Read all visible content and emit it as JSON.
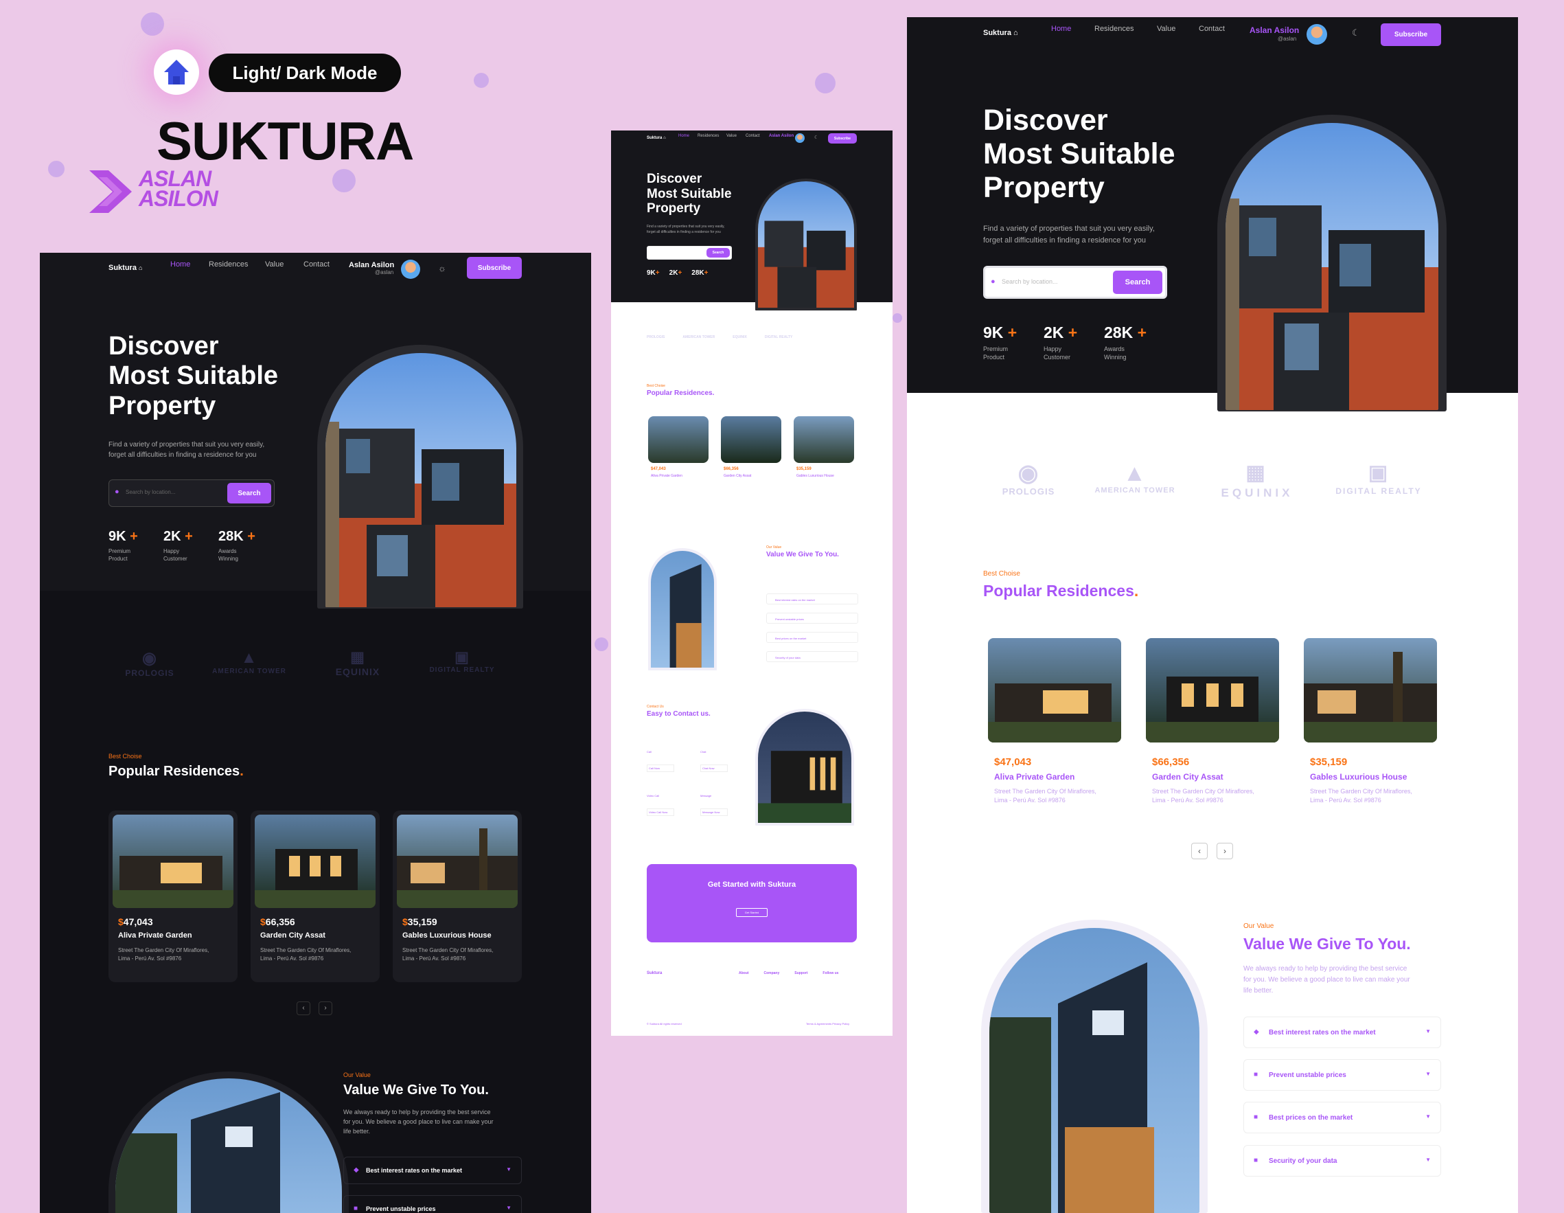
{
  "brand": {
    "mode_pill": "Light/ Dark Mode",
    "title": "SUKTURA",
    "author_line1": "ASLAN",
    "author_line2": "ASILON"
  },
  "nav": {
    "logo": "Suktura",
    "links": [
      "Home",
      "Residences",
      "Value",
      "Contact"
    ],
    "user_name": "Aslan Asilon",
    "user_handle": "@aslan",
    "subscribe": "Subscribe"
  },
  "hero": {
    "title_lines": [
      "Discover",
      "Most Suitable",
      "Property"
    ],
    "subtitle_1": "Find a variety of properties that suit you very easily,",
    "subtitle_2": "forget all difficulties in finding a residence for you",
    "search_placeholder": "Search by location...",
    "search_button": "Search",
    "stats": [
      {
        "num": "9K",
        "plus": "+",
        "label1": "Premium",
        "label2": "Product"
      },
      {
        "num": "2K",
        "plus": "+",
        "label1": "Happy",
        "label2": "Customer"
      },
      {
        "num": "28K",
        "plus": "+",
        "label1": "Awards",
        "label2": "Winning"
      }
    ]
  },
  "partners": [
    "PROLOGIS",
    "AMERICAN TOWER",
    "EQUINIX",
    "DIGITAL REALTY"
  ],
  "residences": {
    "eyebrow": "Best Choise",
    "title": "Popular Residences",
    "dot": ".",
    "cards": [
      {
        "price_sign": "$",
        "price": "47,043",
        "name": "Aliva Private Garden",
        "addr1": "Street The Garden City Of Miraflores,",
        "addr2": "Lima - Perú Av. Sol #9876"
      },
      {
        "price_sign": "$",
        "price": "66,356",
        "name": "Garden City Assat",
        "addr1": "Street The Garden City Of Miraflores,",
        "addr2": "Lima - Perú Av. Sol #9876"
      },
      {
        "price_sign": "$",
        "price": "35,159",
        "name": "Gables Luxurious House",
        "addr1": "Street The Garden City Of Miraflores,",
        "addr2": "Lima - Perú Av. Sol #9876"
      }
    ]
  },
  "value": {
    "eyebrow": "Our Value",
    "title": "Value We Give To You.",
    "desc_1": "We always ready to help by providing the best service",
    "desc_2": "for you. We believe a good place to live can make your",
    "desc_3": "life better.",
    "items": [
      "Best interest rates on the market",
      "Prevent unstable prices",
      "Best prices on the market",
      "Security of your data"
    ]
  },
  "contact": {
    "eyebrow": "Contact Us",
    "title": "Easy to Contact us.",
    "channels": [
      "Call",
      "Chat",
      "Video Call",
      "Message"
    ],
    "actions": [
      "Call Now",
      "Chat Now",
      "Video Call Now",
      "Message Now"
    ]
  },
  "cta": {
    "title": "Get Started with Suktura",
    "button": "Get Started"
  },
  "footer": {
    "cols": [
      "About",
      "Company",
      "Support",
      "Follow us"
    ],
    "copyright": "© Suktura All rights reserved",
    "legal": "Terms & Agreements    Privacy Policy"
  },
  "colors": {
    "accent": "#a855f7",
    "orange": "#f97316",
    "dark": "#111116",
    "bg": "#ecc9e8"
  }
}
